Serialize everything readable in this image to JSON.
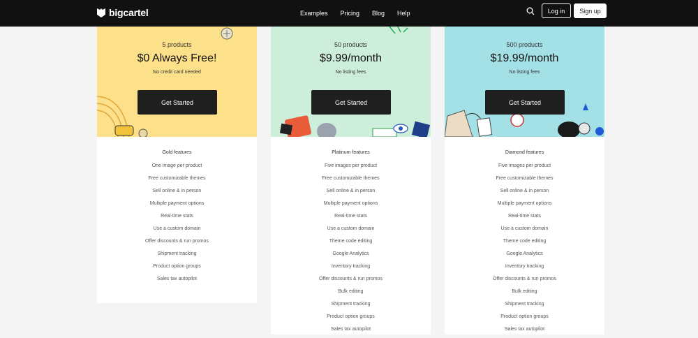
{
  "header": {
    "brand": "bigcartel",
    "nav": [
      "Examples",
      "Pricing",
      "Blog",
      "Help"
    ],
    "login_label": "Log in",
    "signup_label": "Sign up"
  },
  "plans": [
    {
      "count": "5 products",
      "price": "$0 Always Free!",
      "note": "No credit card needed",
      "cta": "Get Started",
      "features_title": "Gold features",
      "color": "#fde08a",
      "features": [
        "One image per product",
        "Free customizable themes",
        "Sell online & in person",
        "Multiple payment options",
        "Real-time stats",
        "Use a custom domain",
        "Offer discounts & run promos",
        "Shipment tracking",
        "Product option groups",
        "Sales tax autopilot"
      ]
    },
    {
      "count": "50 products",
      "price": "$9.99/month",
      "note": "No listing fees",
      "cta": "Get Started",
      "features_title": "Platinum features",
      "color": "#cdeedb",
      "features": [
        "Five images per product",
        "Free customizable themes",
        "Sell online & in person",
        "Multiple payment options",
        "Real-time stats",
        "Use a custom domain",
        "Theme code editing",
        "Google Analytics",
        "Inventory tracking",
        "Offer discounts & run promos",
        "Bulk editing",
        "Shipment tracking",
        "Product option groups",
        "Sales tax autopilot"
      ]
    },
    {
      "count": "500 products",
      "price": "$19.99/month",
      "note": "No listing fees",
      "cta": "Get Started",
      "features_title": "Diamond features",
      "color": "#a4e1e6",
      "features": [
        "Five images per product",
        "Free customizable themes",
        "Sell online & in person",
        "Multiple payment options",
        "Real-time stats",
        "Use a custom domain",
        "Theme code editing",
        "Google Analytics",
        "Inventory tracking",
        "Offer discounts & run promos",
        "Bulk editing",
        "Shipment tracking",
        "Product option groups",
        "Sales tax autopilot"
      ]
    }
  ]
}
